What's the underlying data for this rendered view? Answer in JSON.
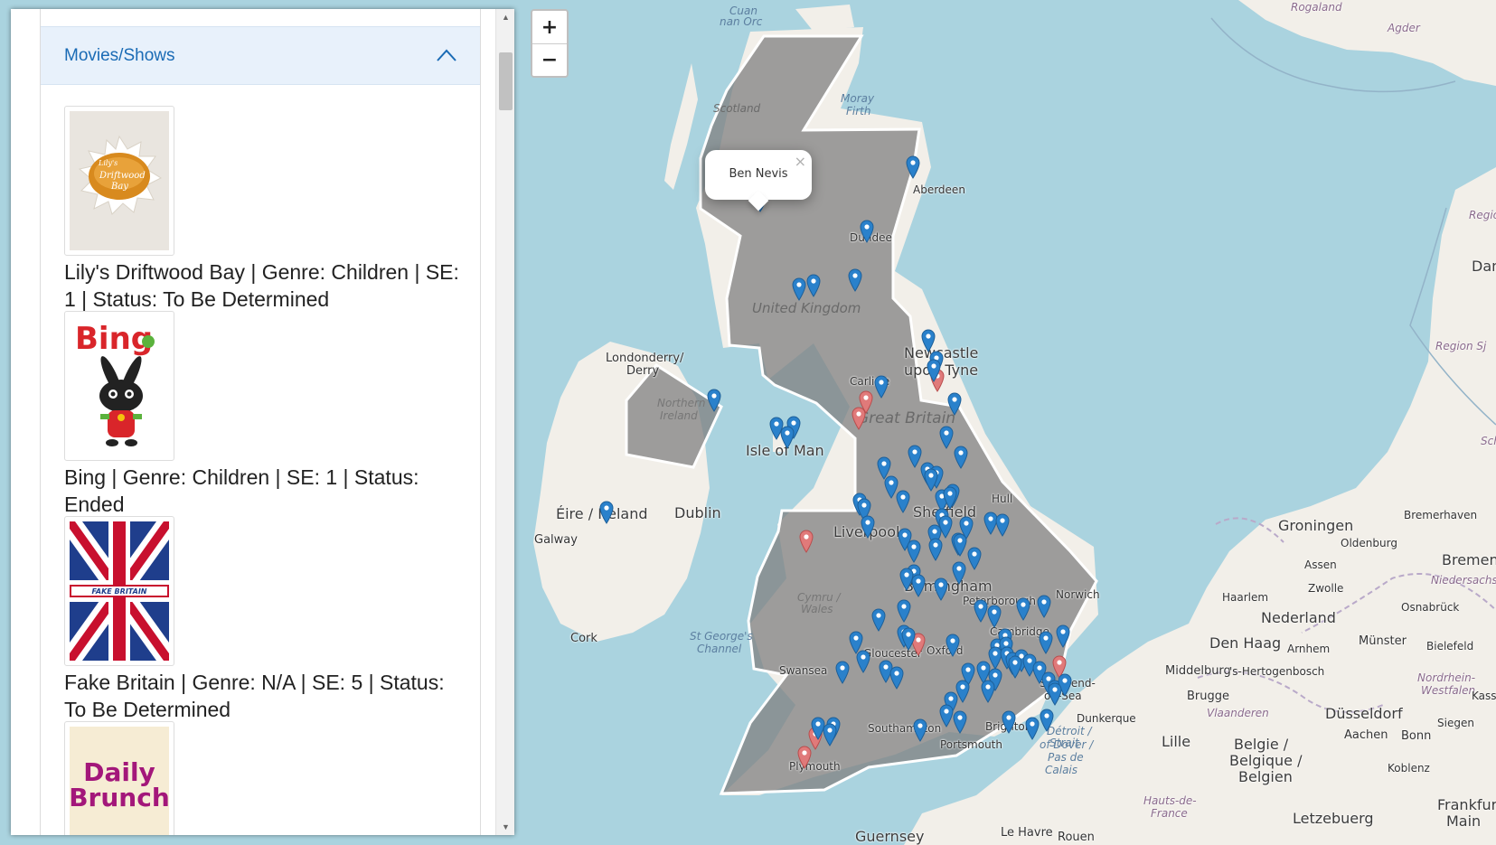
{
  "panel": {
    "section_title": "Movies/Shows",
    "shows": [
      {
        "caption": "Lily's Driftwood Bay | Genre: Children | SE: 1 | Status: To Be Determined",
        "poster_text": "Lily's Driftwood Bay"
      },
      {
        "caption": "Bing | Genre: Children | SE: 1 | Status: Ended",
        "poster_text": "Bing"
      },
      {
        "caption": "Fake Britain | Genre: N/A | SE: 5 | Status: To Be Determined",
        "poster_text": "FAKE BRITAIN"
      },
      {
        "caption": "",
        "poster_text": "Daily Brunch"
      }
    ]
  },
  "map": {
    "zoom_in": "+",
    "zoom_out": "−",
    "popup": {
      "text": "Ben Nevis",
      "close": "×"
    },
    "labels": {
      "cuan": "Cuan",
      "norc": "nan Orc",
      "rogaland": "Rogaland",
      "agder": "Agder",
      "scotland": "Scotland",
      "moray": "Moray",
      "firth": "Firth",
      "aberdeen": "Aberdeen",
      "dundee": "Dundee",
      "uk": "United Kingdom",
      "londonderry": "Londonderry/",
      "derry": "Derry",
      "newcastle1": "Newcastle",
      "newcastle2": "upon Tyne",
      "carlisle": "Carlisle",
      "greatbritain": "Great Britain",
      "northern": "Northern",
      "ireland_ni": "Ireland",
      "isleofman": "Isle of Man",
      "eire": "Éire / Ireland",
      "dublin": "Dublin",
      "galway": "Galway",
      "liverpool": "Liverpool",
      "sheffield": "Sheffield",
      "hull": "Hull",
      "groningen": "Groningen",
      "bremerhaven": "Bremerhaven",
      "oldenburg": "Oldenburg",
      "bremen": "Bremen",
      "assen": "Assen",
      "niedersachsen": "Niedersachsen",
      "haarlem": "Haarlem",
      "zwolle": "Zwolle",
      "osnabruck": "Osnabrück",
      "nederland": "Nederland",
      "denhaag": "Den Haag",
      "arnhem": "Arnhem",
      "munster": "Münster",
      "bielefeld": "Bielefeld",
      "peterborough": "Peterborough",
      "norwich": "Norwich",
      "birmingham": "Birmingham",
      "cymru": "Cymru /",
      "wales": "Wales",
      "stgeorges1": "St George's",
      "stgeorges2": "Channel",
      "cork": "Cork",
      "gloucester": "Gloucester",
      "oxford": "Oxford",
      "cambridge": "Cambridge",
      "southend": "Southend-",
      "onsea": "on-Sea",
      "swansea": "Swansea",
      "middelburg": "Middelburg",
      "hertogenbosch": "'s-Hertogenbosch",
      "nordrhein": "Nordrhein-",
      "westfalen": "Westfalen",
      "brugge": "Brugge",
      "vlaanderen": "Vlaanderen",
      "dusseldorf": "Düsseldorf",
      "siegen": "Siegen",
      "kassel": "Kasse",
      "dunkerque": "Dunkerque",
      "southampton": "Southampton",
      "portsmouth": "Portsmouth",
      "brighton": "Brighton",
      "detroit1": "Détroit /",
      "detroit2": "Strait",
      "dover1": "of Dover /",
      "dover2": "Pas de",
      "dover3": "Calais",
      "aachen": "Aachen",
      "bonn": "Bonn",
      "lille": "Lille",
      "belgie1": "Belgie /",
      "belgie2": "Belgique /",
      "belgie3": "Belgien",
      "koblenz": "Koblenz",
      "hauts1": "Hauts-de-",
      "hauts2": "France",
      "plymouth": "Plymouth",
      "letzebuerg": "Letzebuerg",
      "frankfurt1": "Frankfurt",
      "frankfurt2": "Main",
      "lehavre": "Le Havre",
      "rouen": "Rouen",
      "guernsey": "Guernsey",
      "region_sj": "Region Sj",
      "regio": "Regio",
      "dan": "Dan",
      "sch": "Sch"
    },
    "blue_marker_count": 93,
    "red_marker_count": 8
  }
}
